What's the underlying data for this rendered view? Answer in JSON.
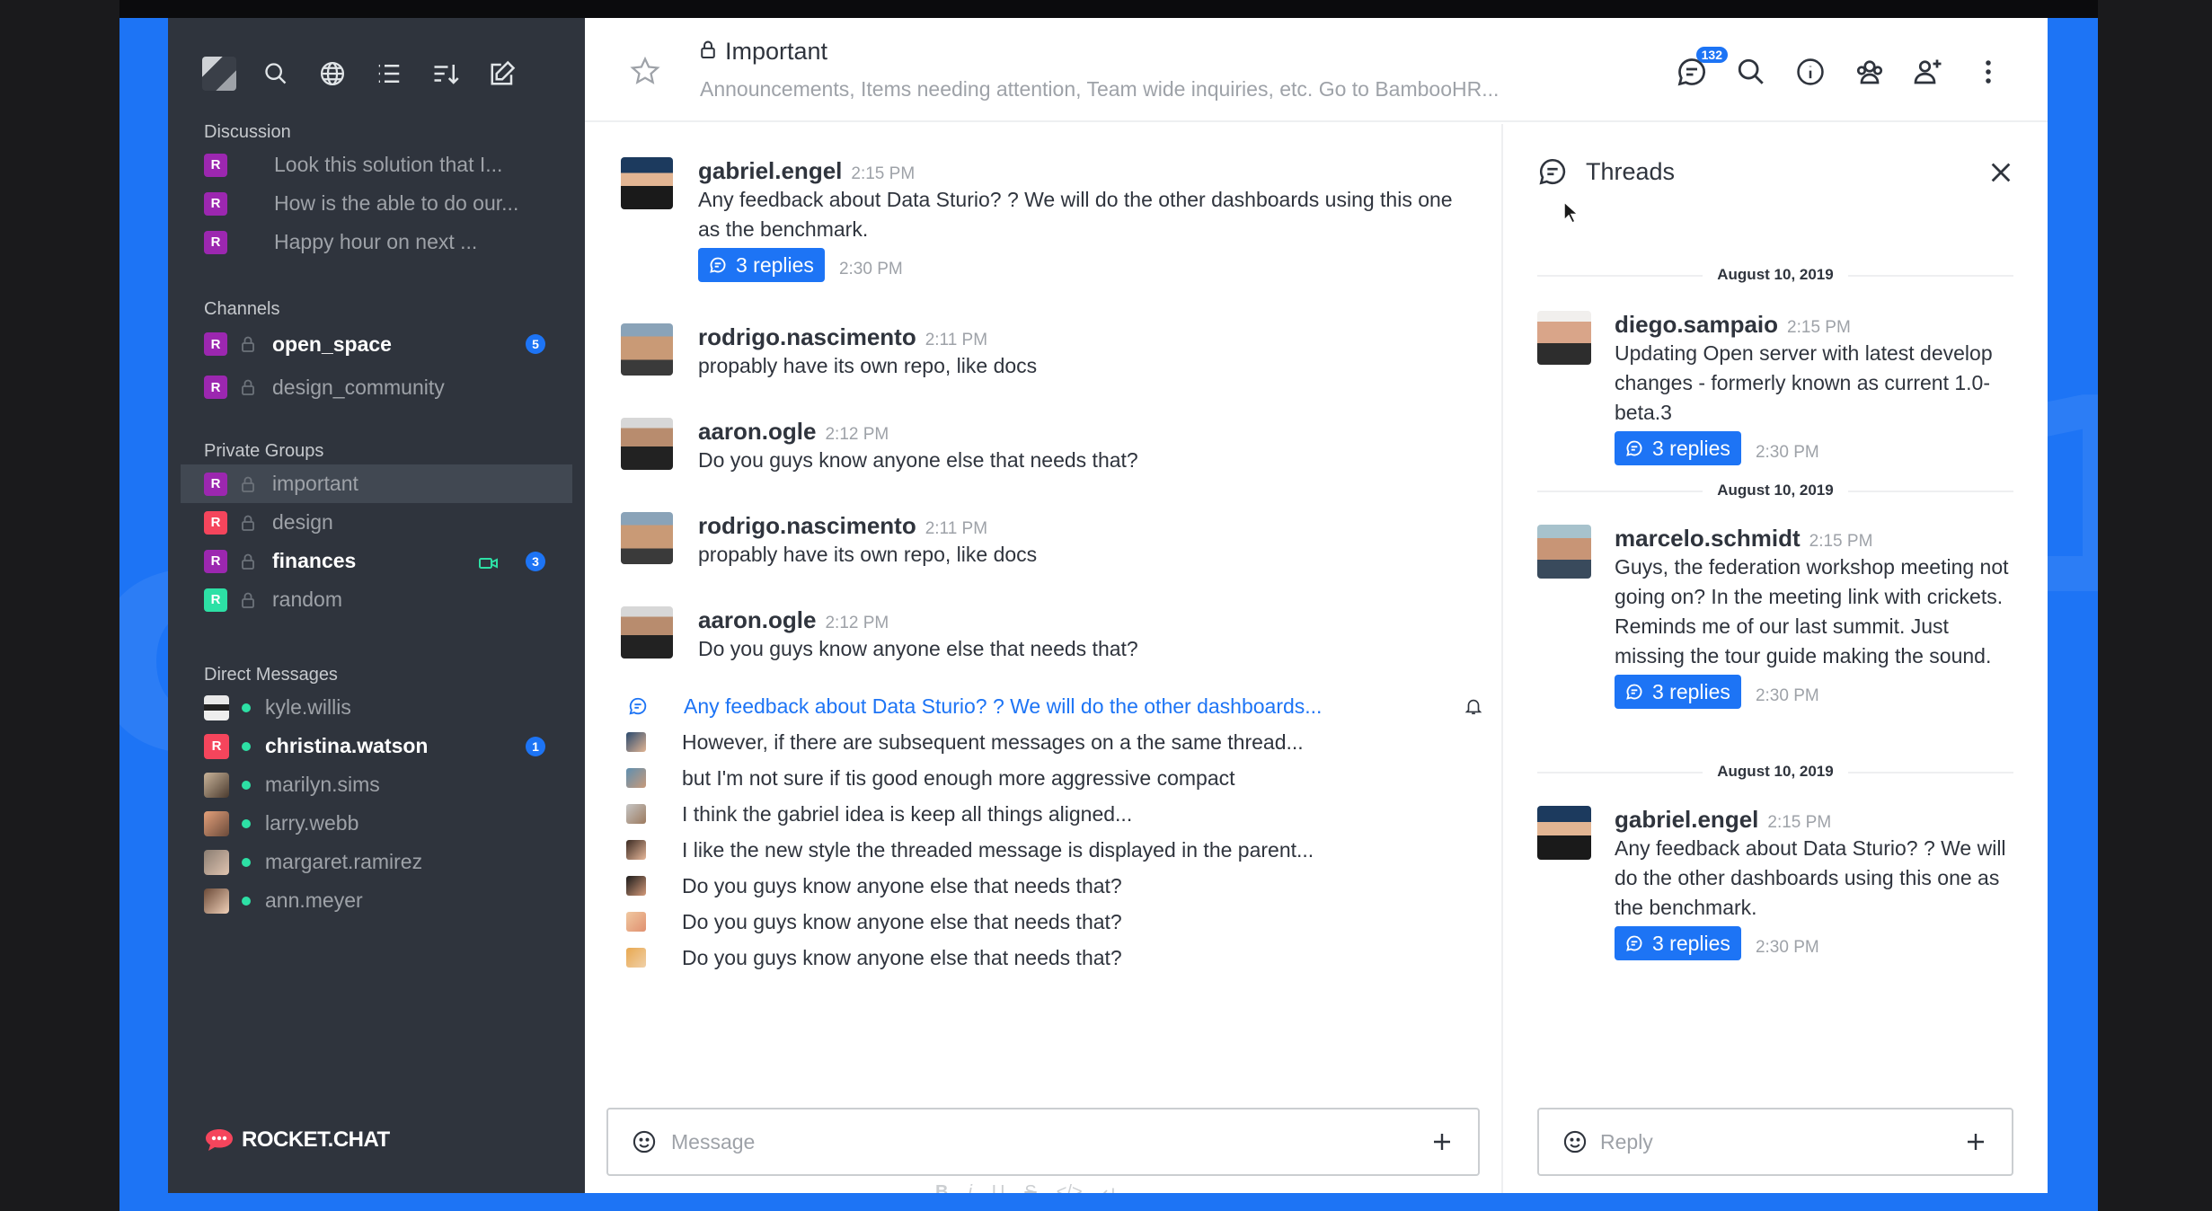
{
  "colors": {
    "accent": "#1d74f5",
    "sidebar": "#2f343d",
    "online": "#2de0a5"
  },
  "sidebar": {
    "toolbar_icons": [
      "avatar",
      "search-icon",
      "globe-icon",
      "list-icon",
      "sort-icon",
      "edit-icon"
    ],
    "discussion": {
      "header": "Discussion",
      "items": [
        {
          "avatar": "R",
          "label": "Look this solution that I..."
        },
        {
          "avatar": "R",
          "label": "How is the able to do our..."
        },
        {
          "avatar": "R",
          "label": "Happy hour on next ..."
        }
      ]
    },
    "channels": {
      "header": "Channels",
      "items": [
        {
          "avatar": "R",
          "label": "open_space",
          "badge": "5"
        },
        {
          "avatar": "R",
          "label": "design_community"
        }
      ]
    },
    "private_groups": {
      "header": "Private Groups",
      "items": [
        {
          "avatar": "R",
          "label": "important"
        },
        {
          "avatar": "R",
          "label": "design"
        },
        {
          "avatar": "R",
          "label": "finances",
          "badge": "3"
        },
        {
          "avatar": "R",
          "label": "random"
        }
      ]
    },
    "direct_messages": {
      "header": "Direct Messages",
      "items": [
        {
          "label": "kyle.willis"
        },
        {
          "avatar": "R",
          "label": "christina.watson",
          "badge": "1"
        },
        {
          "label": "marilyn.sims"
        },
        {
          "label": "larry.webb"
        },
        {
          "label": "margaret.ramirez"
        },
        {
          "label": "ann.meyer"
        }
      ]
    },
    "logo_text": "ROCKET.CHAT"
  },
  "header": {
    "title": "Important",
    "topic": "Announcements, Items needing attention, Team wide inquiries, etc. Go to BambooHR...",
    "threads_badge": "132"
  },
  "messages": [
    {
      "user": "gabriel.engel",
      "time": "2:15 PM",
      "text": "Any feedback about Data Sturio? ? We will do the other dashboards using this one as the benchmark.",
      "replies": "3 replies",
      "reply_time": "2:30 PM"
    },
    {
      "user": "rodrigo.nascimento",
      "time": "2:11 PM",
      "text": "propably have its own repo, like docs"
    },
    {
      "user": "aaron.ogle",
      "time": "2:12 PM",
      "text": "Do you guys know anyone else that needs that?"
    },
    {
      "user": "rodrigo.nascimento",
      "time": "2:11 PM",
      "text": "propably have its own repo, like docs"
    },
    {
      "user": "aaron.ogle",
      "time": "2:12 PM",
      "text": "Do you guys know anyone else that needs that?"
    }
  ],
  "thread_sequence": [
    "Any feedback about Data Sturio? ? We will do the other dashboards...",
    "However, if there are subsequent messages on a the same thread...",
    "but I'm not sure if tis good enough more aggressive compact",
    "I think the gabriel idea is keep all things aligned...",
    "I like the new style the threaded message is displayed in the parent...",
    "Do you guys know anyone else that needs that?",
    "Do you guys know anyone else that needs that?",
    "Do you guys know anyone else that needs that?"
  ],
  "composer": {
    "placeholder": "Message",
    "format_buttons": [
      "B",
      "i",
      "U",
      "S",
      "</>",
      "↵"
    ]
  },
  "threads_panel": {
    "title": "Threads",
    "items": [
      {
        "date": "August 10, 2019",
        "user": "diego.sampaio",
        "time": "2:15 PM",
        "text": "Updating Open server with latest develop changes - formerly known as current 1.0-beta.3",
        "replies": "3 replies",
        "reply_time": "2:30 PM"
      },
      {
        "date": "August 10, 2019",
        "user": "marcelo.schmidt",
        "time": "2:15 PM",
        "text": "Guys, the federation workshop meeting not going on? In the meeting link with crickets. Reminds me of our last summit. Just missing the tour guide making the sound.",
        "replies": "3 replies",
        "reply_time": "2:30 PM"
      },
      {
        "date": "August 10, 2019",
        "user": "gabriel.engel",
        "time": "2:15 PM",
        "text": "Any feedback about Data Sturio? ? We will do the other dashboards using this one as the benchmark.",
        "replies": "3 replies",
        "reply_time": "2:30 PM"
      }
    ],
    "reply_placeholder": "Reply"
  }
}
